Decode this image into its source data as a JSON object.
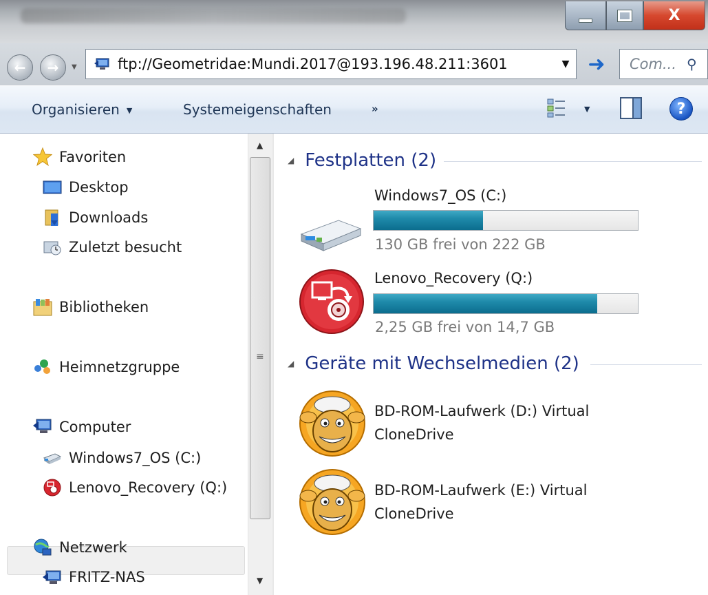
{
  "window": {
    "minimize_label": "",
    "maximize_label": "",
    "close_label": "X"
  },
  "address": {
    "value": "ftp://Geometridae:Mundi.2017@193.196.48.211:3601",
    "search_placeholder": "Com..."
  },
  "toolbar": {
    "organize": "Organisieren",
    "system_properties": "Systemeigenschaften",
    "more": "»"
  },
  "sidebar": {
    "favorites": "Favoriten",
    "desktop": "Desktop",
    "downloads": "Downloads",
    "recent": "Zuletzt besucht",
    "libraries": "Bibliotheken",
    "homegroup": "Heimnetzgruppe",
    "computer": "Computer",
    "drive_c": "Windows7_OS (C:)",
    "drive_q": "Lenovo_Recovery (Q:)",
    "network": "Netzwerk",
    "nas": "FRITZ-NAS"
  },
  "groups": {
    "hard_drives": "Festplatten (2)",
    "removable": "Geräte mit Wechselmedien (2)"
  },
  "drives": [
    {
      "name": "Windows7_OS (C:)",
      "free_text": "130 GB frei von 222 GB",
      "used_fraction": 0.4144
    },
    {
      "name": "Lenovo_Recovery (Q:)",
      "free_text": "2,25 GB frei von 14,7 GB",
      "used_fraction": 0.847
    }
  ],
  "devices": [
    {
      "line1": "BD-ROM-Laufwerk (D:) Virtual",
      "line2": "CloneDrive"
    },
    {
      "line1": "BD-ROM-Laufwerk (E:) Virtual",
      "line2": "CloneDrive"
    }
  ],
  "colors": {
    "group_header": "#1e3287",
    "bar_fill": "#1f8aaa",
    "close_button": "#c2301a"
  },
  "icons": {
    "back": "back-arrow-icon",
    "forward": "forward-arrow-icon",
    "go": "go-arrow-icon",
    "search": "magnifier-icon",
    "help": "help-icon"
  }
}
